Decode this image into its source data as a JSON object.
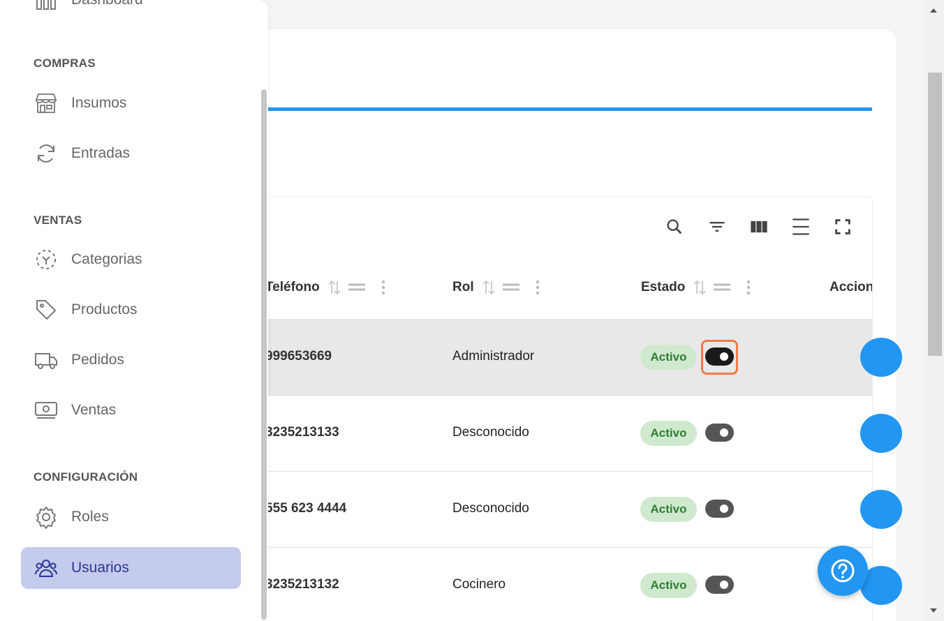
{
  "sidebar": {
    "top_item": "Dashboard",
    "sections": [
      {
        "title": "COMPRAS"
      },
      {
        "title": "VENTAS"
      },
      {
        "title": "CONFIGURACIÓN"
      }
    ],
    "items": [
      {
        "label": "Insumos",
        "icon": "store-icon"
      },
      {
        "label": "Entradas",
        "icon": "refresh-icon"
      },
      {
        "label": "Categorias",
        "icon": "category-icon"
      },
      {
        "label": "Productos",
        "icon": "tag-icon"
      },
      {
        "label": "Pedidos",
        "icon": "truck-icon"
      },
      {
        "label": "Ventas",
        "icon": "cash-icon"
      },
      {
        "label": "Roles",
        "icon": "gear-icon"
      },
      {
        "label": "Usuarios",
        "icon": "users-icon",
        "active": true
      }
    ]
  },
  "table": {
    "toolbar": [
      "search-icon",
      "filter-icon",
      "columns-icon",
      "density-icon",
      "fullscreen-icon"
    ],
    "columns": [
      "Teléfono",
      "Rol",
      "Estado",
      "Acciones"
    ],
    "rows": [
      {
        "phone": "999653669",
        "role": "Administrador",
        "status": "Activo"
      },
      {
        "phone": "3235213133",
        "role": "Desconocido",
        "status": "Activo"
      },
      {
        "phone": "555 623 4444",
        "role": "Desconocido",
        "status": "Activo"
      },
      {
        "phone": "3235213132",
        "role": "Cocinero",
        "status": "Activo"
      }
    ]
  },
  "colors": {
    "accent": "#2196f3",
    "active_nav": "#c5cbec",
    "badge_bg": "#cfe9cf",
    "badge_text": "#2e7d32",
    "focus": "#f07a4a"
  }
}
